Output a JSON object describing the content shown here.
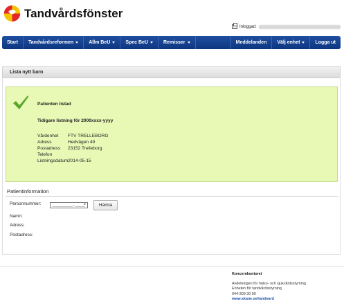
{
  "app": {
    "title": "Tandvårdsfönster"
  },
  "header": {
    "logged_in_label": "Inloggad:"
  },
  "nav": {
    "left": [
      {
        "label": "Start",
        "caret": false
      },
      {
        "label": "Tandvårdsreformen",
        "caret": true
      },
      {
        "label": "Allm BeU",
        "caret": true
      },
      {
        "label": "Spec BeU",
        "caret": true
      },
      {
        "label": "Remisser",
        "caret": true
      }
    ],
    "right": [
      {
        "label": "Meddelanden",
        "caret": false
      },
      {
        "label": "Välj enhet",
        "caret": true
      },
      {
        "label": "Logga ut",
        "caret": false
      }
    ]
  },
  "page": {
    "heading": "Lista nytt barn"
  },
  "success": {
    "title": "Patienten listad",
    "subtitle": "Tidigare listning för 2000xxxx-yyyy",
    "details": [
      {
        "label": "Vårdenhet",
        "value": "FTV TRELLEBORG"
      },
      {
        "label": "Adress",
        "value": "Hedvägen 49"
      },
      {
        "label": "Postadress",
        "value": "23152 Trelleborg"
      },
      {
        "label": "Telefon",
        "value": ""
      },
      {
        "label": "Listningsdatum",
        "value": "2014-05-15"
      }
    ]
  },
  "patient": {
    "section_title": "Patientinformation",
    "personnummer_label": "Personnummer:",
    "personnummer_value": "________-____",
    "clear_symbol": "×",
    "fetch_button": "Hämta",
    "namn_label": "Namn:",
    "adress_label": "Adress:",
    "postadress_label": "Postadress:"
  },
  "footer": {
    "title": "Koncernkontoret",
    "line1": "Avdelningen för hälso- och sjukvårdsstyrning",
    "line2": "Enheten för tandvårdsstyrning",
    "phone": "044-309 30 00",
    "link": "www.skane.se/tandvard"
  },
  "colors": {
    "nav_bg": "#1f4fa0",
    "success_bg": "#e8f8b5",
    "check": "#5aa82a",
    "logo_red": "#e3262c",
    "logo_yellow": "#f5c400"
  }
}
